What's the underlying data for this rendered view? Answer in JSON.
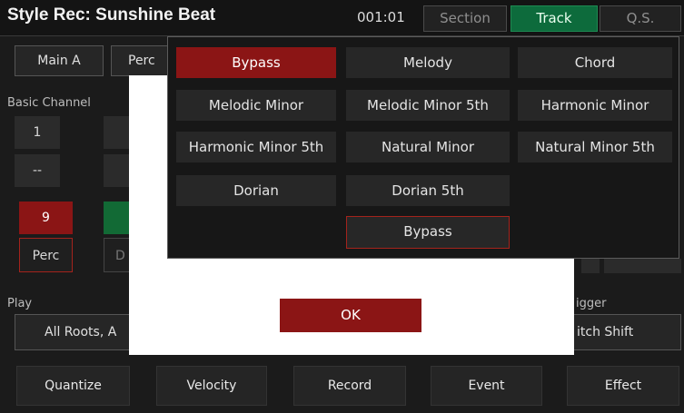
{
  "header": {
    "title": "Style Rec: Sunshine Beat",
    "position": "001:01",
    "tabs": [
      {
        "label": "Section",
        "active": false
      },
      {
        "label": "Track",
        "active": true
      },
      {
        "label": "Q.S.",
        "active": false
      }
    ]
  },
  "top_row": {
    "main_a": "Main A",
    "perc_partial": "Perc"
  },
  "basic_channel": {
    "label": "Basic Channel",
    "number": "1",
    "dash": "--",
    "selected_number": "9",
    "selected_name": "Perc",
    "partial_letter": "D"
  },
  "play": {
    "label": "Play",
    "value_partial": "All Roots, A"
  },
  "trigger": {
    "label_partial": "igger",
    "value_partial": "itch Shift"
  },
  "bottom_buttons": [
    "Quantize",
    "Velocity",
    "Record",
    "Event",
    "Effect"
  ],
  "dropdown": {
    "options": [
      "Bypass",
      "Melody",
      "Chord",
      "Melodic Minor",
      "Melodic Minor 5th",
      "Harmonic Minor",
      "Harmonic Minor 5th",
      "Natural Minor",
      "Natural Minor 5th",
      "Dorian",
      "Dorian 5th",
      "Bypass"
    ],
    "selected": "Bypass"
  },
  "dialog": {
    "ok_label": "OK"
  },
  "colors": {
    "accent_red": "#8b1515",
    "accent_green": "#0d6b3c",
    "background": "#1b1b1b"
  }
}
